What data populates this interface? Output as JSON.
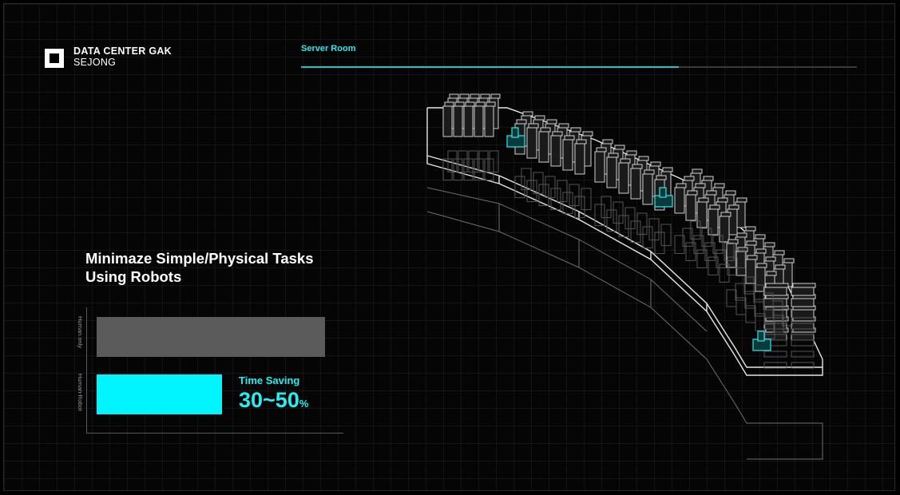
{
  "brand": {
    "line1": "DATA CENTER GAK",
    "line2": "SEJONG",
    "logo_icon": "square-logo-icon"
  },
  "tab": {
    "label": "Server Room",
    "progress": 0.68,
    "accent": "#14c8cc"
  },
  "headline": {
    "line1": "Minimaze Simple/Physical Tasks",
    "line2": "Using Robots"
  },
  "chart_data": {
    "type": "bar",
    "orientation": "horizontal",
    "categories": [
      "Human only",
      "Human-Robot"
    ],
    "values": [
      100,
      55
    ],
    "colors": [
      "#5b5b5b",
      "#00f5ff"
    ],
    "annotation": {
      "label": "Time Saving",
      "value": "30~50",
      "unit": "%"
    }
  },
  "illustration": {
    "icon": "server-room-isometric-icon",
    "robot_icon": "robot-icon"
  }
}
